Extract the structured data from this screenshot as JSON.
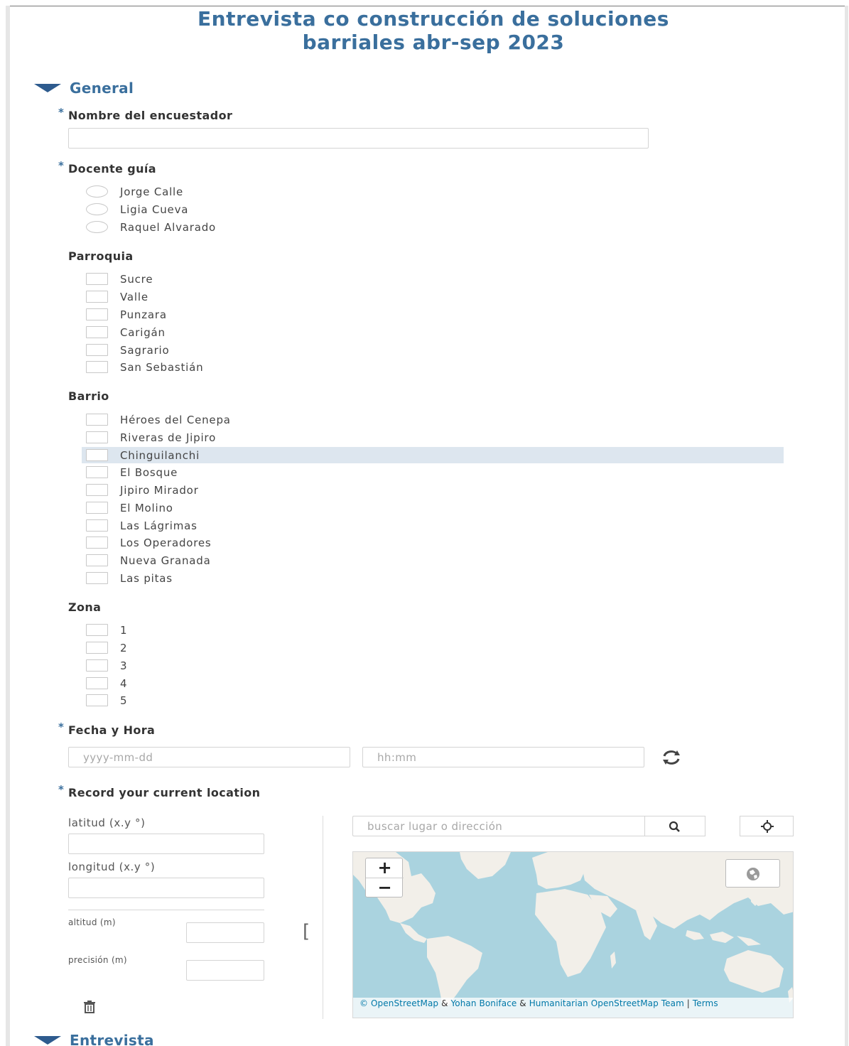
{
  "form": {
    "title_line1": "Entrevista co construcción de soluciones",
    "title_line2": "barriales abr-sep 2023"
  },
  "sections": {
    "general_label": "General",
    "entrevista_label": "Entrevista"
  },
  "questions": {
    "encuestador": {
      "required_mark": "*",
      "label": "Nombre del encuestador",
      "value": ""
    },
    "docente": {
      "required_mark": "*",
      "label": "Docente guía",
      "options": [
        "Jorge Calle",
        "Ligia Cueva",
        "Raquel Alvarado"
      ]
    },
    "parroquia": {
      "label": "Parroquia",
      "options": [
        "Sucre",
        "Valle",
        "Punzara",
        "Carigán",
        "Sagrario",
        "San Sebastián"
      ]
    },
    "barrio": {
      "label": "Barrio",
      "options": [
        "Héroes del Cenepa",
        "Riveras de Jipiro",
        "Chinguilanchi",
        "El Bosque",
        "Jipiro Mirador",
        "El Molino",
        "Las Lágrimas",
        "Los Operadores",
        "Nueva Granada",
        "Las pitas"
      ],
      "highlighted": "Chinguilanchi"
    },
    "zona": {
      "label": "Zona",
      "options": [
        "1",
        "2",
        "3",
        "4",
        "5"
      ]
    },
    "fecha_hora": {
      "required_mark": "*",
      "label": "Fecha y Hora",
      "date_placeholder": "yyyy-mm-dd",
      "time_placeholder": "hh:mm"
    },
    "location": {
      "required_mark": "*",
      "label": "Record your current location",
      "lat_label": "latitud (x.y °)",
      "lng_label": "longitud (x.y °)",
      "alt_label": "altitud (m)",
      "acc_label": "precisión (m)",
      "bracket": "[",
      "search_placeholder": "buscar lugar o dirección",
      "zoom_in": "+",
      "zoom_out": "−",
      "attribution_osm": "© OpenStreetMap",
      "attribution_amp1": " & ",
      "attribution_yohan": "Yohan Boniface",
      "attribution_amp2": " & ",
      "attribution_hot": "Humanitarian OpenStreetMap Team",
      "attribution_sep": " | ",
      "attribution_terms": "Terms"
    }
  },
  "colors": {
    "accent": "#3a6f9d",
    "caret": "#2e5b8e",
    "highlight": "#dde6ef",
    "map_water": "#aad3df",
    "map_land": "#f2efe9"
  }
}
